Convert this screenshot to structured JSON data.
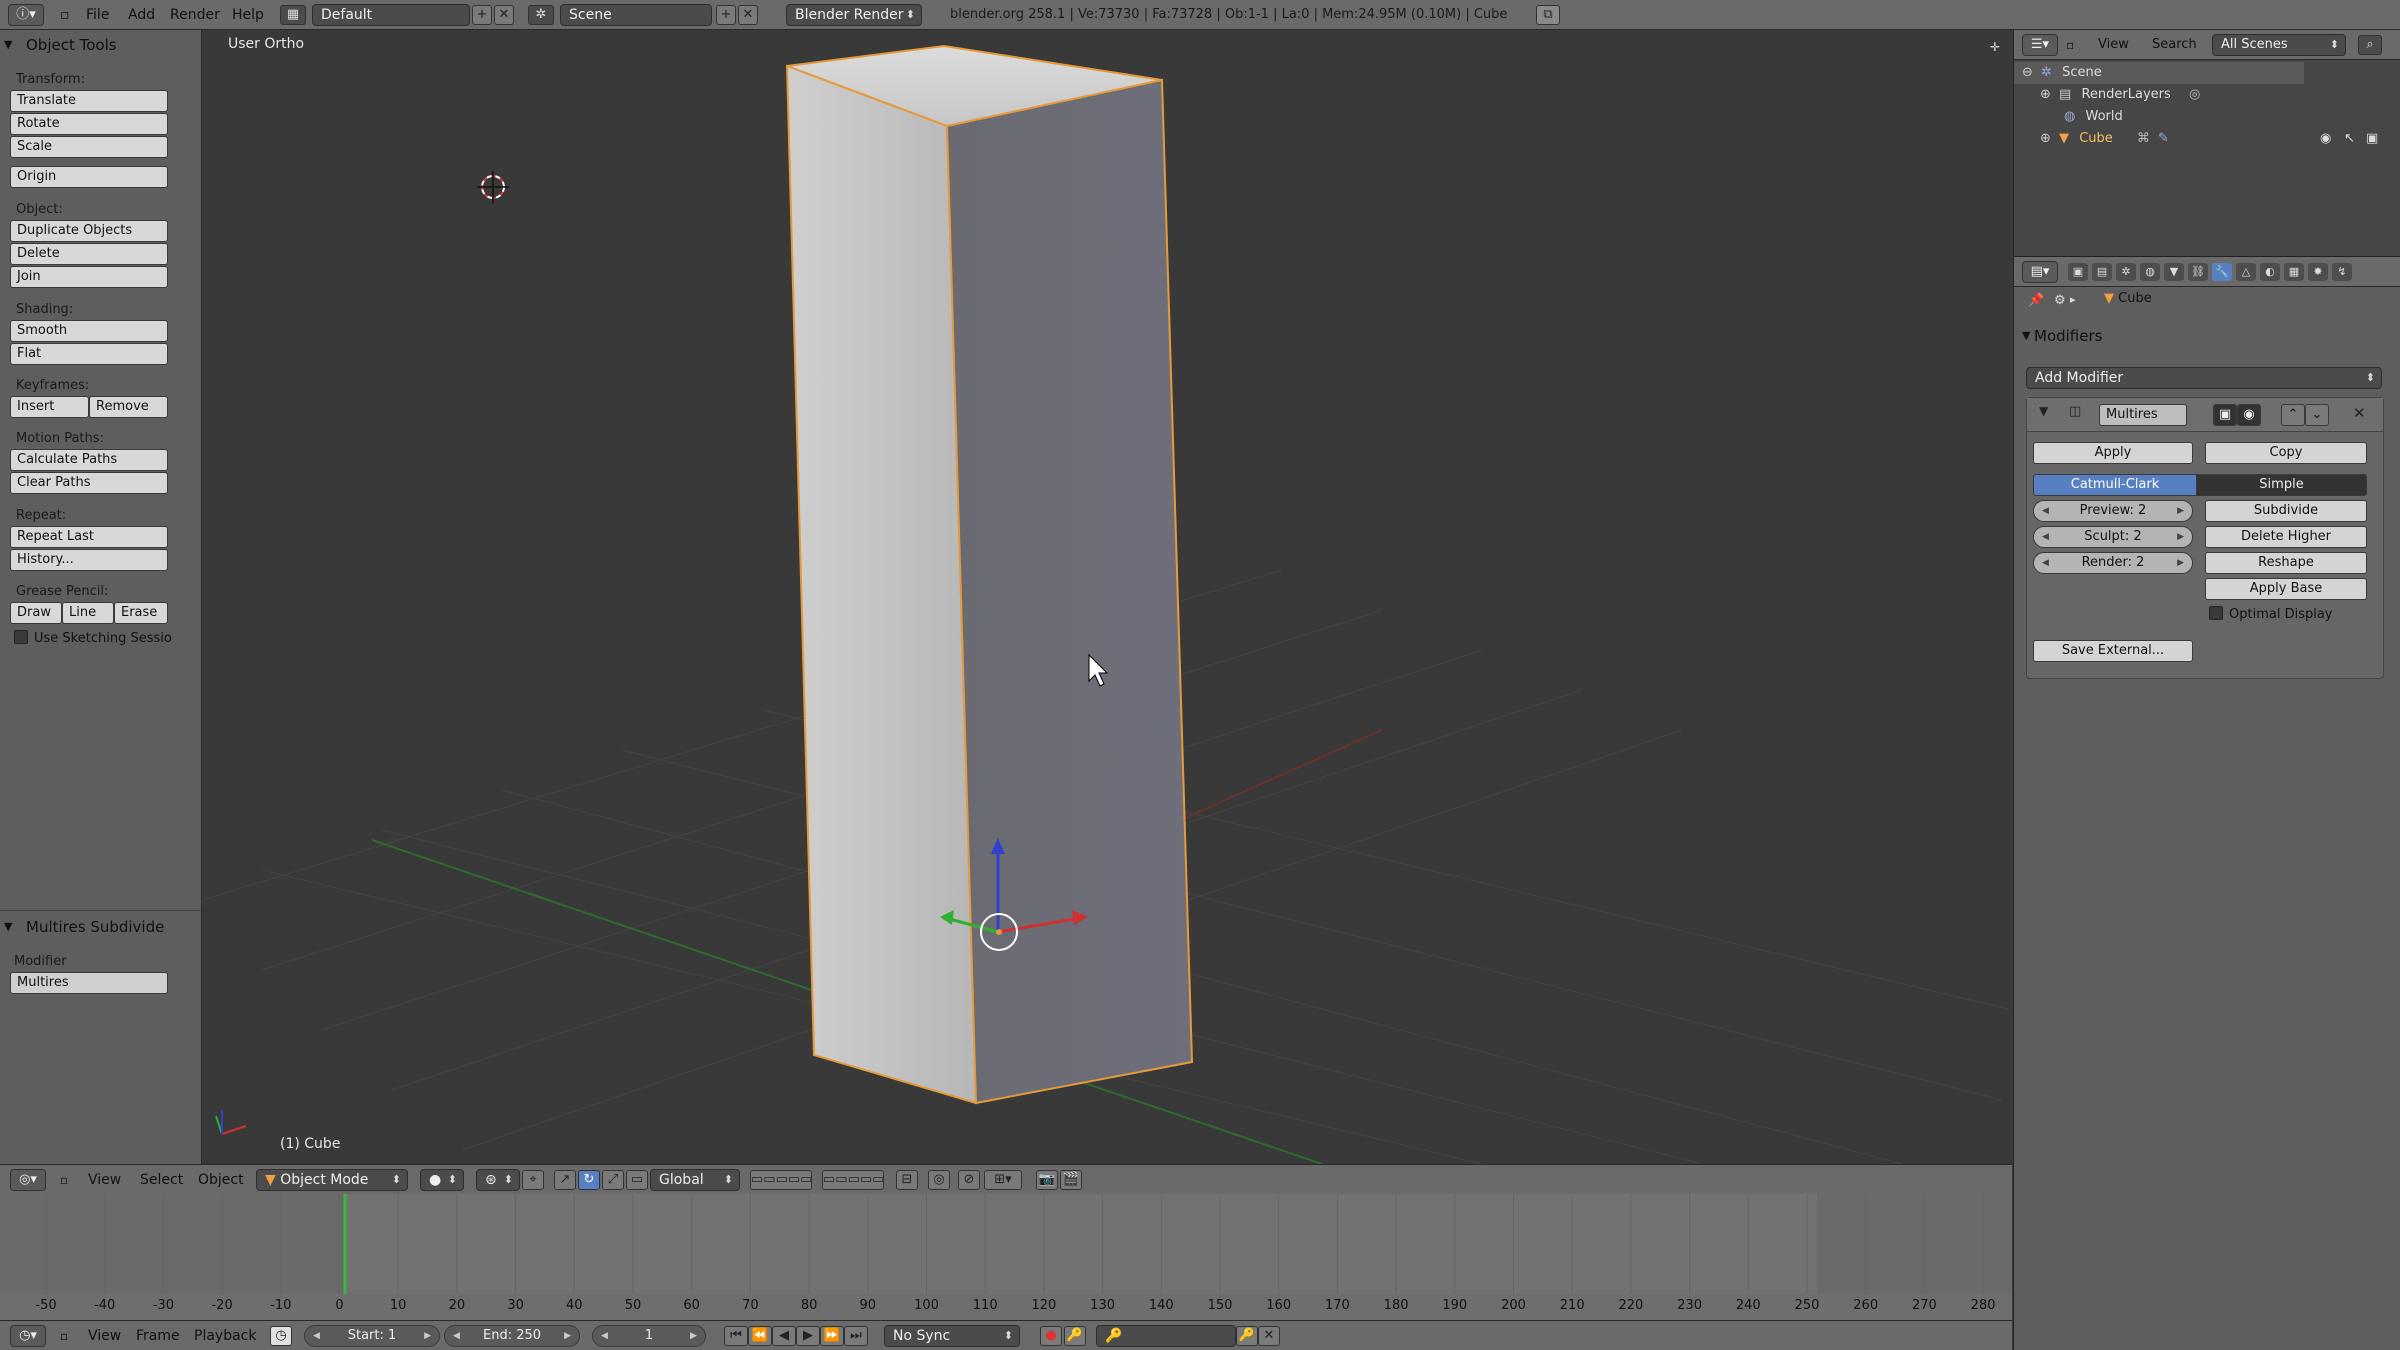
{
  "app": {
    "top_menu": [
      "File",
      "Add",
      "Render",
      "Help"
    ],
    "screen_layout": "Default",
    "scene": "Scene",
    "render_engine": "Blender Render",
    "stats": "blender.org 258.1 | Ve:73730 | Fa:73728 | Ob:1-1 | La:0 | Mem:24.95M (0.10M) | Cube"
  },
  "tool_shelf": {
    "title": "Object Tools",
    "transform_label": "Transform:",
    "translate": "Translate",
    "rotate": "Rotate",
    "scale": "Scale",
    "origin": "Origin",
    "object_label": "Object:",
    "duplicate": "Duplicate Objects",
    "delete": "Delete",
    "join": "Join",
    "shading_label": "Shading:",
    "smooth": "Smooth",
    "flat": "Flat",
    "keyframes_label": "Keyframes:",
    "insert": "Insert",
    "remove": "Remove",
    "motion_label": "Motion Paths:",
    "calc_paths": "Calculate Paths",
    "clear_paths": "Clear Paths",
    "repeat_label": "Repeat:",
    "repeat_last": "Repeat Last",
    "history": "History...",
    "grease_label": "Grease Pencil:",
    "draw": "Draw",
    "line": "Line",
    "erase": "Erase",
    "use_sketching": "Use Sketching Sessio",
    "operator_title": "Multires Subdivide",
    "modifier_label": "Modifier",
    "modifier_value": "Multires"
  },
  "viewport": {
    "view_name": "User Ortho",
    "object_label": "(1) Cube"
  },
  "viewport_header": {
    "menus": [
      "View",
      "Select",
      "Object"
    ],
    "mode": "Object Mode",
    "orientation": "Global"
  },
  "outliner": {
    "view": "View",
    "search": "Search",
    "filter": "All Scenes",
    "items": [
      {
        "label": "Scene"
      },
      {
        "label": "RenderLayers"
      },
      {
        "label": "World"
      },
      {
        "label": "Cube"
      }
    ]
  },
  "properties": {
    "breadcrumb": "Cube",
    "modifiers_title": "Modifiers",
    "add_modifier": "Add Modifier",
    "modifier_name": "Multires",
    "apply": "Apply",
    "copy": "Copy",
    "catmull": "Catmull-Clark",
    "simple": "Simple",
    "preview": "Preview: 2",
    "sculpt": "Sculpt: 2",
    "render": "Render: 2",
    "subdivide": "Subdivide",
    "delete_higher": "Delete Higher",
    "reshape": "Reshape",
    "apply_base": "Apply Base",
    "optimal_display": "Optimal Display",
    "save_external": "Save External..."
  },
  "timeline": {
    "menus": [
      "View",
      "Frame",
      "Playback"
    ],
    "start": "Start: 1",
    "end": "End: 250",
    "current": "1",
    "sync": "No Sync",
    "ticks": [
      "-50",
      "-40",
      "-30",
      "-20",
      "-10",
      "0",
      "10",
      "20",
      "30",
      "40",
      "50",
      "60",
      "70",
      "80",
      "90",
      "100",
      "110",
      "120",
      "130",
      "140",
      "150",
      "160",
      "170",
      "180",
      "190",
      "200",
      "210",
      "220",
      "230",
      "240",
      "250",
      "260",
      "270",
      "280"
    ]
  },
  "colors": {
    "accent": "#5680c2",
    "selection_outline": "#f0a040"
  }
}
